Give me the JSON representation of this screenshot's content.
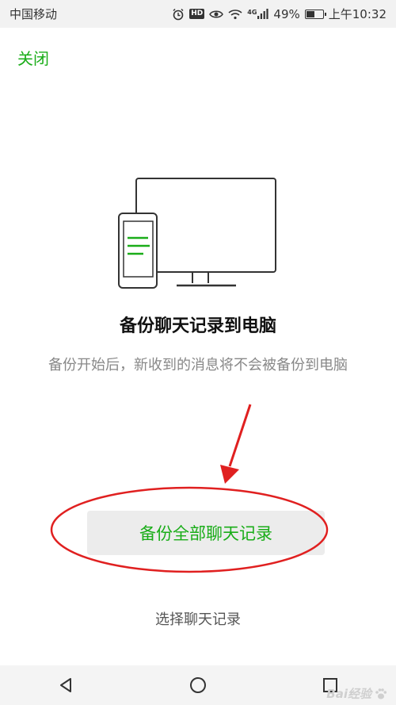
{
  "status_bar": {
    "carrier": "中国移动",
    "network": "4G",
    "battery": "49%",
    "battery_level": 0.49,
    "time": "上午10:32",
    "icons": [
      "alarm-icon",
      "hd-icon",
      "eye-icon",
      "wifi-icon",
      "signal-icon",
      "battery-icon"
    ],
    "hd_label": "HD"
  },
  "header": {
    "close_label": "关闭"
  },
  "main": {
    "title": "备份聊天记录到电脑",
    "subtitle": "备份开始后，新收到的消息将不会被备份到电脑",
    "primary_button": "备份全部聊天记录",
    "secondary_link": "选择聊天记录"
  },
  "nav": {
    "icons": [
      "back-icon",
      "home-icon",
      "recents-icon"
    ]
  },
  "watermark": {
    "text": "Bai经验"
  },
  "colors": {
    "accent": "#1aad19",
    "annotation": "#e02020",
    "text_dark": "#111111",
    "text_muted": "#888888"
  }
}
